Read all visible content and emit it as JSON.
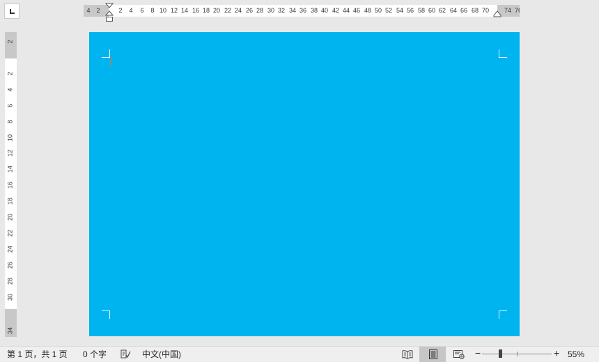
{
  "ruler": {
    "horizontal_ticks": [
      "4",
      "2",
      "2",
      "4",
      "6",
      "8",
      "10",
      "12",
      "14",
      "16",
      "18",
      "20",
      "22",
      "24",
      "26",
      "28",
      "30",
      "32",
      "34",
      "36",
      "38",
      "40",
      "42",
      "44",
      "46",
      "48",
      "50",
      "52",
      "54",
      "56",
      "58",
      "60",
      "62",
      "64",
      "66",
      "68",
      "70",
      "74",
      "76"
    ],
    "vertical_ticks": [
      "2",
      "2",
      "4",
      "6",
      "8",
      "10",
      "12",
      "14",
      "16",
      "18",
      "20",
      "22",
      "24",
      "26",
      "28",
      "30",
      "34"
    ]
  },
  "page": {
    "background": "#00b4f0"
  },
  "statusbar": {
    "page_info": "第 1 页，共 1 页",
    "word_count": "0 个字",
    "language": "中文(中国)",
    "zoom": "55%",
    "zoom_out": "−",
    "zoom_in": "+"
  }
}
